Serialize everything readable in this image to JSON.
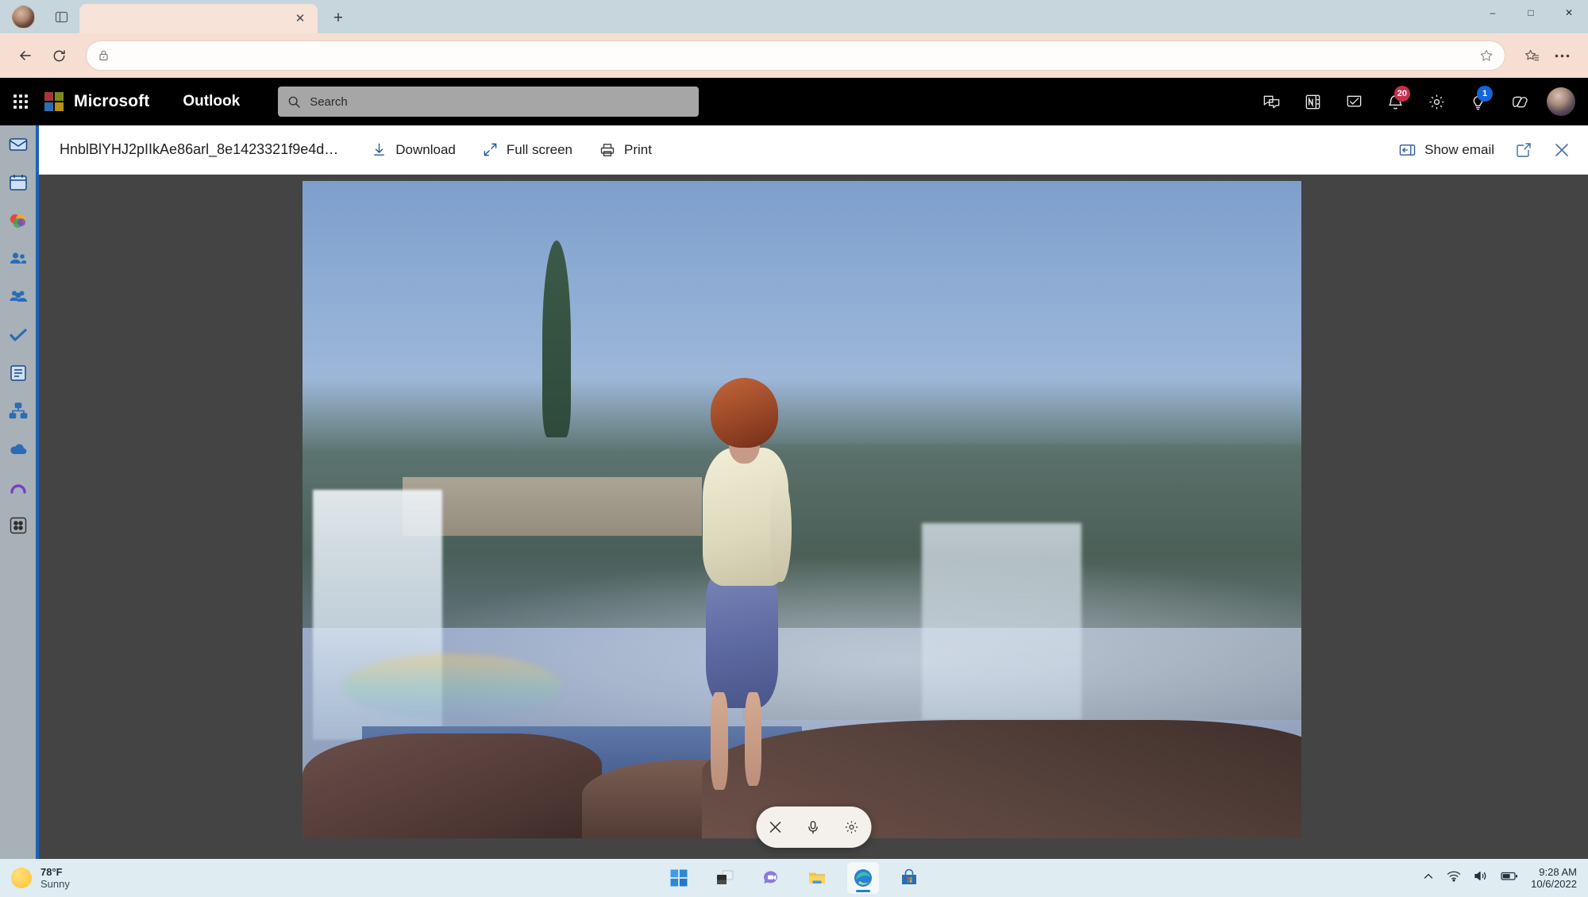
{
  "browser": {
    "profile_avatar": "profile-avatar",
    "tab_list_icon": "tab-list-icon",
    "tab": {
      "title": "",
      "close_label": "✕"
    },
    "new_tab_label": "+",
    "window_controls": {
      "minimize": "–",
      "maximize": "□",
      "close": "✕"
    },
    "nav": {
      "back_label": "back-arrow",
      "refresh_label": "refresh-arrow",
      "url_value": "",
      "url_placeholder": "",
      "lock_icon": "lock-icon",
      "star_icon": "favorite-star-icon",
      "collections_icon": "collections-icon",
      "more_icon": "more-options-icon"
    }
  },
  "outlook": {
    "waffle_label": "app-launcher",
    "brand": "Microsoft",
    "app_name": "Outlook",
    "search": {
      "placeholder": "Search",
      "value": ""
    },
    "header_icons": [
      {
        "name": "teams-chat-icon",
        "badge": ""
      },
      {
        "name": "onenote-icon",
        "badge": ""
      },
      {
        "name": "todo-icon",
        "badge": ""
      },
      {
        "name": "notifications-bell-icon",
        "badge": "20",
        "badge_color": "red"
      },
      {
        "name": "settings-gear-icon",
        "badge": ""
      },
      {
        "name": "tips-lightbulb-icon",
        "badge": "1",
        "badge_color": "blue"
      },
      {
        "name": "copilot-icon",
        "badge": ""
      }
    ],
    "avatar_label": "user-avatar",
    "rail_items": [
      {
        "name": "sidebar-item-mail",
        "label": "Mail"
      },
      {
        "name": "sidebar-item-calendar",
        "label": "Calendar"
      },
      {
        "name": "sidebar-item-apps-colorful",
        "label": "Apps"
      },
      {
        "name": "sidebar-item-people",
        "label": "People"
      },
      {
        "name": "sidebar-item-groups",
        "label": "Groups"
      },
      {
        "name": "sidebar-item-todo",
        "label": "To Do"
      },
      {
        "name": "sidebar-item-files",
        "label": "Files"
      },
      {
        "name": "sidebar-item-org",
        "label": "Org"
      },
      {
        "name": "sidebar-item-onedrive",
        "label": "OneDrive"
      },
      {
        "name": "sidebar-item-purple-app",
        "label": "App"
      },
      {
        "name": "sidebar-item-more-apps",
        "label": "More apps"
      }
    ]
  },
  "attachment_toolbar": {
    "file_name": "HnblBlYHJ2pIIkAe86arl_8e1423321f9e4d…",
    "download_label": "Download",
    "fullscreen_label": "Full screen",
    "print_label": "Print",
    "show_email_label": "Show email",
    "popout_label": "pop-out",
    "close_label": "✕"
  },
  "viewer": {
    "image_alt": "Woman standing on rocks in front of a waterfall",
    "controls": [
      {
        "name": "close-icon",
        "glyph": "✕"
      },
      {
        "name": "microphone-icon",
        "glyph": "mic"
      },
      {
        "name": "settings-gear-icon",
        "glyph": "gear"
      }
    ]
  },
  "taskbar": {
    "weather": {
      "temperature": "78°F",
      "condition": "Sunny"
    },
    "apps": [
      {
        "name": "start-button",
        "label": "Start"
      },
      {
        "name": "task-view-button",
        "label": "Task View"
      },
      {
        "name": "teams-chat-button",
        "label": "Chat"
      },
      {
        "name": "file-explorer-button",
        "label": "File Explorer"
      },
      {
        "name": "edge-browser-button",
        "label": "Microsoft Edge",
        "active": true
      },
      {
        "name": "microsoft-store-button",
        "label": "Microsoft Store"
      }
    ],
    "tray": {
      "chevron": "show-hidden-icons",
      "wifi": "wifi-icon",
      "volume": "volume-icon",
      "battery": "battery-icon",
      "time": "9:28 AM",
      "date": "10/6/2022"
    }
  },
  "colors": {
    "accent_blue": "#1b63b4",
    "badge_red": "#c4314b",
    "badge_blue": "#1565d8",
    "header_black": "#000000",
    "browser_chrome": "#f7ded2",
    "taskbar": "#dfecf2"
  }
}
